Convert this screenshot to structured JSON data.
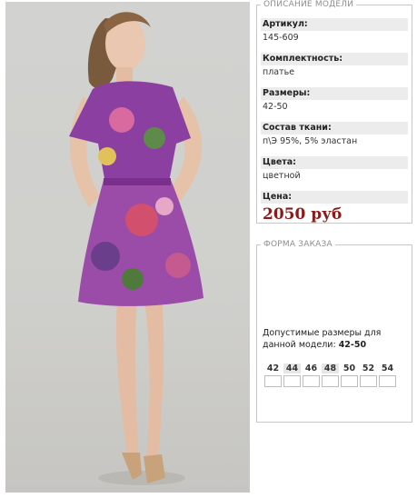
{
  "photo": {
    "alt_icon": "model-photo"
  },
  "description": {
    "legend": "ОПИСАНИЕ МОДЕЛИ",
    "rows": [
      {
        "label": "Артикул:",
        "value": "145-609"
      },
      {
        "label": "Комплектность:",
        "value": "платье"
      },
      {
        "label": "Размеры:",
        "value": "42-50"
      },
      {
        "label": "Состав ткани:",
        "value": "п\\Э 95%, 5% эластан"
      },
      {
        "label": "Цвета:",
        "value": "цветной"
      }
    ],
    "price_label": "Цена:",
    "price": "2050 руб"
  },
  "order": {
    "legend": "ФОРМА ЗАКАЗА",
    "note_prefix": "Допустимые размеры для данной модели: ",
    "note_value": "42-50",
    "sizes": [
      "42",
      "44",
      "46",
      "48",
      "50",
      "52",
      "54"
    ]
  },
  "colors": {
    "price": "#8b1a1a",
    "label_bg": "#ececec",
    "border": "#c8c8c8"
  }
}
